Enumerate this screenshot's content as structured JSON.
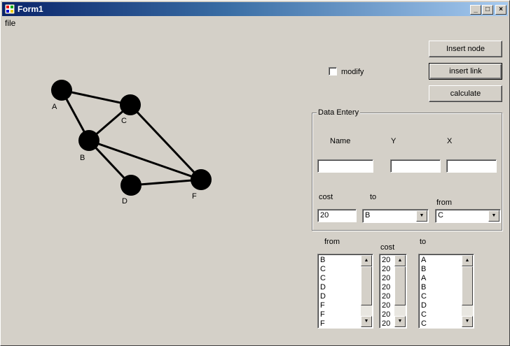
{
  "window": {
    "title": "Form1",
    "min_glyph": "_",
    "max_glyph": "□",
    "close_glyph": "×"
  },
  "menu": {
    "file": "file"
  },
  "graph": {
    "nodes": [
      {
        "id": "A",
        "label": "A"
      },
      {
        "id": "C",
        "label": "C"
      },
      {
        "id": "B",
        "label": "B"
      },
      {
        "id": "D",
        "label": "D"
      },
      {
        "id": "F",
        "label": "F"
      }
    ],
    "edges": [
      [
        "A",
        "C"
      ],
      [
        "A",
        "B"
      ],
      [
        "B",
        "C"
      ],
      [
        "B",
        "D"
      ],
      [
        "B",
        "F"
      ],
      [
        "C",
        "F"
      ],
      [
        "D",
        "F"
      ]
    ]
  },
  "controls": {
    "insert_node": "Insert node",
    "insert_link": "insert link",
    "calculate": "calculate",
    "modify": "modify"
  },
  "data_entry": {
    "legend": "Data Entery",
    "name_label": "Name",
    "y_label": "Y",
    "x_label": "X",
    "name_value": "",
    "y_value": "",
    "x_value": "",
    "cost_label": "cost",
    "to_label": "to",
    "from_label": "from",
    "cost_value": "20",
    "to_value": "B",
    "from_value": "C"
  },
  "lists": {
    "from_label": "from",
    "cost_label": "cost",
    "to_label": "to",
    "from_items": [
      "B",
      "C",
      "C",
      "D",
      "D",
      "F",
      "F",
      "F"
    ],
    "cost_items": [
      "20",
      "20",
      "20",
      "20",
      "20",
      "20",
      "20",
      "20"
    ],
    "to_items": [
      "A",
      "B",
      "A",
      "B",
      "C",
      "D",
      "C",
      "C"
    ]
  },
  "icons": {
    "scroll_up": "▲",
    "scroll_down": "▼",
    "dropdown": "▼"
  }
}
